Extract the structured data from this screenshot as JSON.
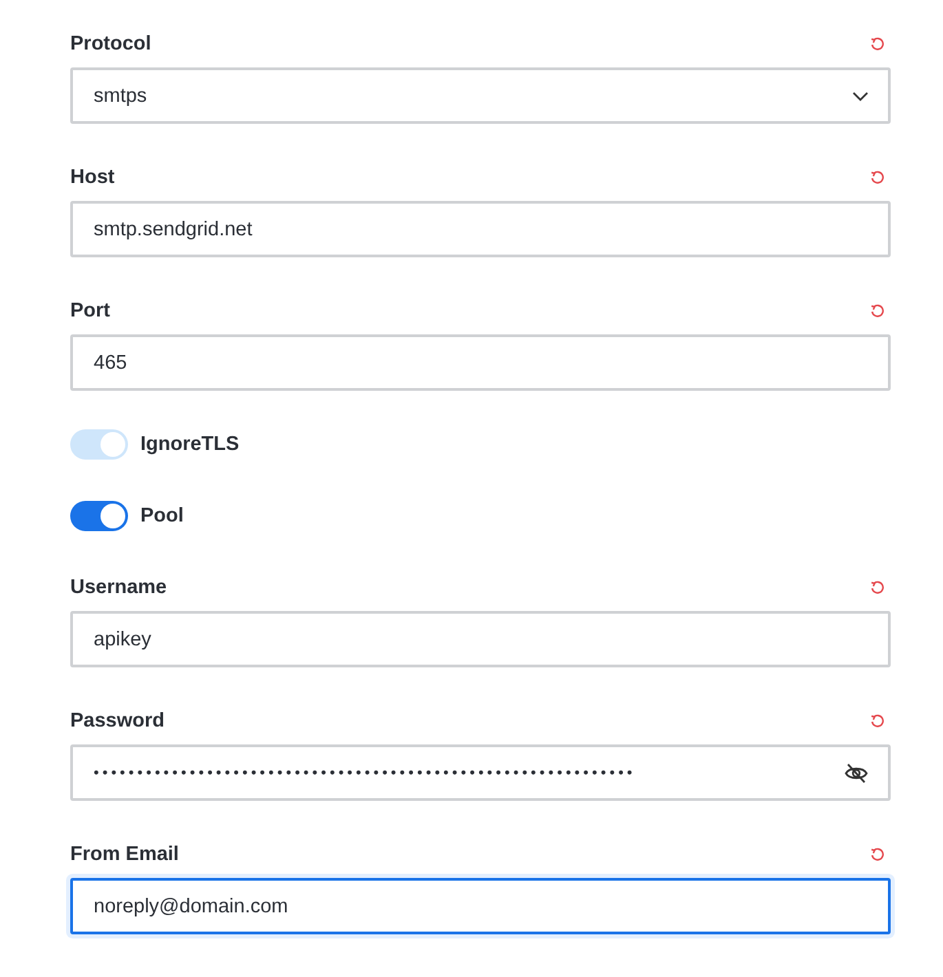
{
  "fields": [
    {
      "kind": "select",
      "label": "Protocol",
      "value": "smtps",
      "focused": false
    },
    {
      "kind": "text",
      "label": "Host",
      "value": "smtp.sendgrid.net",
      "focused": false
    },
    {
      "kind": "text",
      "label": "Port",
      "value": "465",
      "focused": false
    },
    {
      "kind": "toggle",
      "label": "IgnoreTLS",
      "on": true,
      "disabled": true
    },
    {
      "kind": "toggle",
      "label": "Pool",
      "on": true,
      "disabled": false
    },
    {
      "kind": "text",
      "label": "Username",
      "value": "apikey",
      "focused": false
    },
    {
      "kind": "password",
      "label": "Password",
      "value": "••••••••••••••••••••••••••••••••••••••••••••••••••••••••••••••",
      "focused": false
    },
    {
      "kind": "text",
      "label": "From Email",
      "value": "noreply@domain.com",
      "focused": true
    }
  ]
}
